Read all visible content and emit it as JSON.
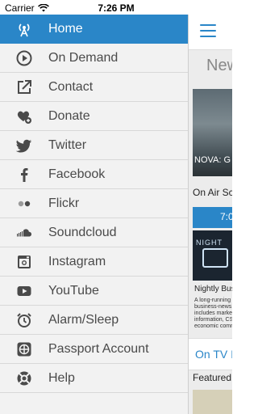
{
  "status_bar": {
    "carrier": "Carrier",
    "time": "7:26 PM"
  },
  "menu": {
    "items": [
      {
        "label": "Home",
        "icon": "radio-tower-icon",
        "active": true
      },
      {
        "label": "On Demand",
        "icon": "play-circle-icon",
        "active": false
      },
      {
        "label": "Contact",
        "icon": "external-link-icon",
        "active": false
      },
      {
        "label": "Donate",
        "icon": "heart-plus-icon",
        "active": false
      },
      {
        "label": "Twitter",
        "icon": "twitter-icon",
        "active": false
      },
      {
        "label": "Facebook",
        "icon": "facebook-icon",
        "active": false
      },
      {
        "label": "Flickr",
        "icon": "flickr-icon",
        "active": false
      },
      {
        "label": "Soundcloud",
        "icon": "soundcloud-icon",
        "active": false
      },
      {
        "label": "Instagram",
        "icon": "instagram-icon",
        "active": false
      },
      {
        "label": "YouTube",
        "icon": "youtube-icon",
        "active": false
      },
      {
        "label": "Alarm/Sleep",
        "icon": "alarm-clock-icon",
        "active": false
      },
      {
        "label": "Passport Account",
        "icon": "passport-compass-icon",
        "active": false
      },
      {
        "label": "Help",
        "icon": "help-icon",
        "active": false
      }
    ]
  },
  "main": {
    "section_title": "New",
    "card_caption": "NOVA: G",
    "on_air": "On Air Sc",
    "time_tab": "7:0",
    "show_logo": "NIGHT",
    "show_title": "Nightly Bus",
    "show_desc": [
      "A long-running",
      "business-news",
      "includes marke",
      "information, CS",
      "economic comm"
    ],
    "on_tv": "On TV I",
    "featured": "Featured"
  },
  "colors": {
    "accent": "#2a86c8",
    "drawer_bg": "#f2f2f2",
    "icon_gray": "#4a4a4a"
  }
}
